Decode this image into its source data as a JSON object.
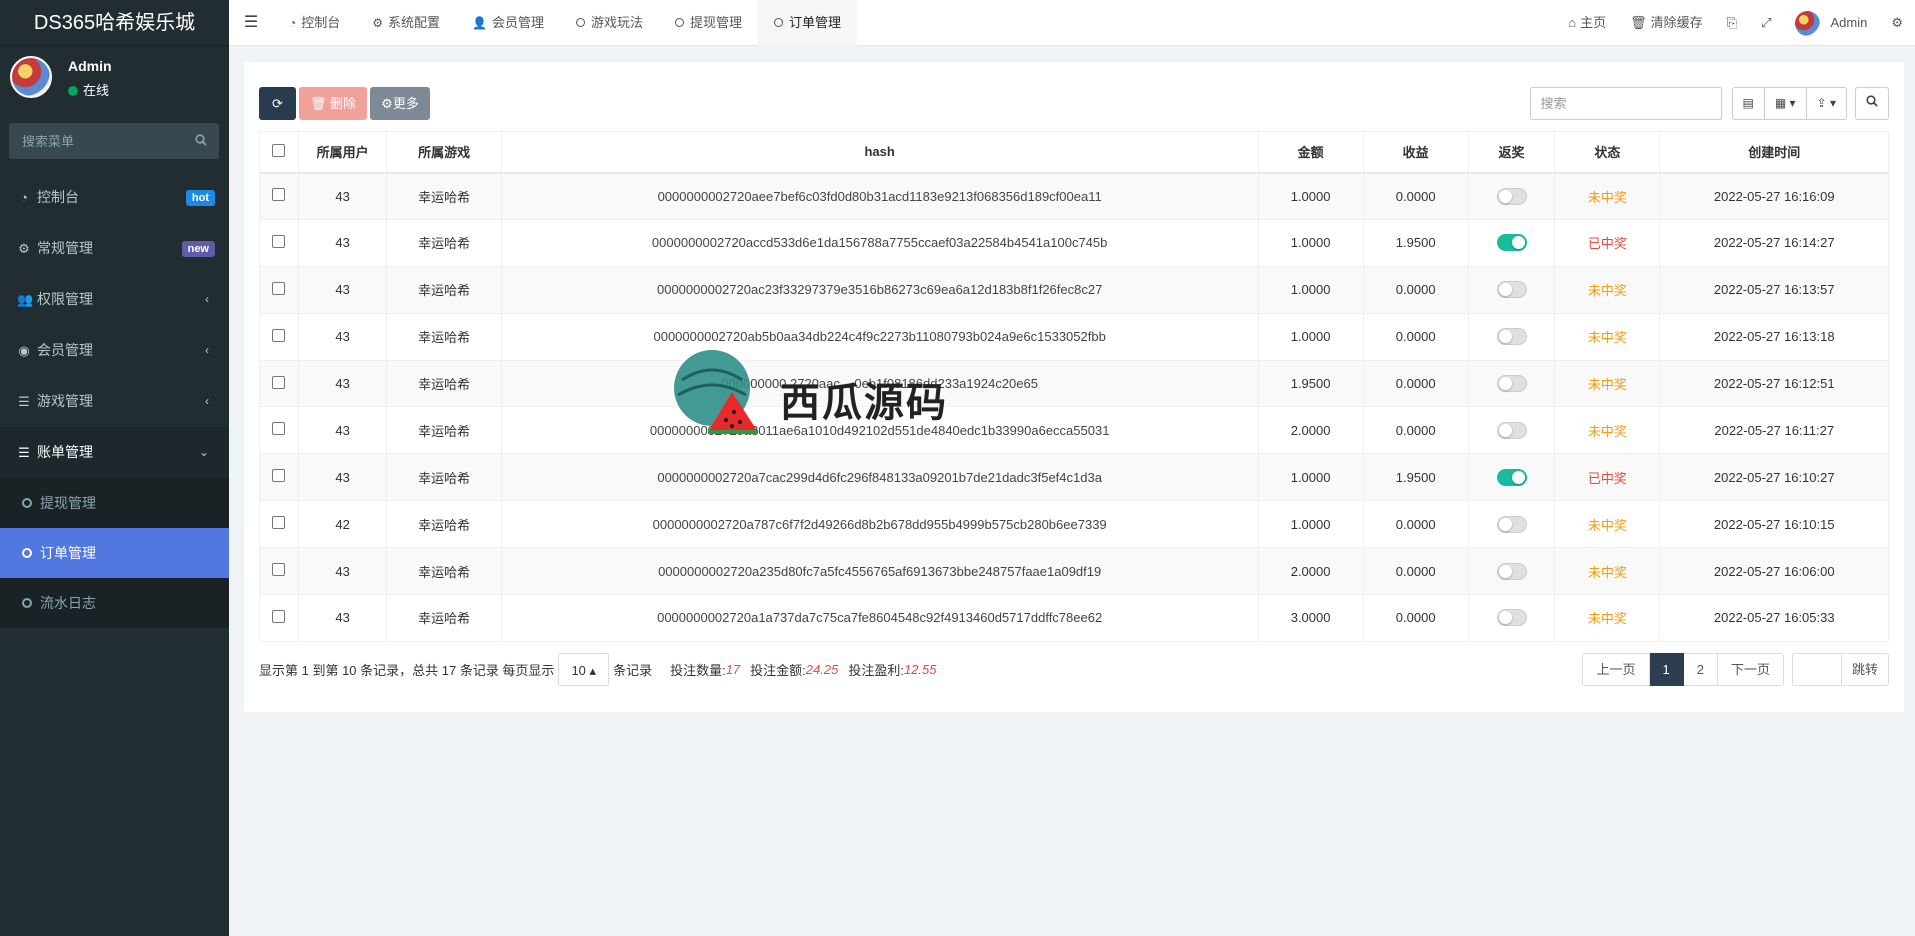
{
  "app": {
    "brand": "DS365哈希娱乐城"
  },
  "user": {
    "name": "Admin",
    "status": "在线"
  },
  "sidebar": {
    "search_placeholder": "搜索菜单",
    "items": [
      {
        "label": "控制台",
        "icon": "dashboard-icon",
        "badge": "hot"
      },
      {
        "label": "常规管理",
        "icon": "cogs-icon",
        "badge": "new"
      },
      {
        "label": "权限管理",
        "icon": "group-icon"
      },
      {
        "label": "会员管理",
        "icon": "user-circle-icon"
      },
      {
        "label": "游戏管理",
        "icon": "list-icon"
      },
      {
        "label": "账单管理",
        "icon": "list-icon"
      }
    ],
    "submenu": [
      {
        "label": "提现管理"
      },
      {
        "label": "订单管理"
      },
      {
        "label": "流水日志"
      }
    ]
  },
  "topbar": {
    "tabs": [
      {
        "label": "控制台",
        "icon": "dashboard-icon"
      },
      {
        "label": "系统配置",
        "icon": "cog-icon"
      },
      {
        "label": "会员管理",
        "icon": "user-icon"
      },
      {
        "label": "游戏玩法",
        "icon": "circle-icon"
      },
      {
        "label": "提现管理",
        "icon": "circle-icon"
      },
      {
        "label": "订单管理",
        "icon": "circle-icon"
      }
    ],
    "home": "主页",
    "clear_cache": "清除缓存",
    "admin": "Admin"
  },
  "toolbar": {
    "delete_label": "删除",
    "more_label": "更多",
    "search_placeholder": "搜索"
  },
  "table": {
    "headers": [
      "所属用户",
      "所属游戏",
      "hash",
      "金额",
      "收益",
      "返奖",
      "状态",
      "创建时间"
    ],
    "rows": [
      {
        "user": "43",
        "game": "幸运哈希",
        "hash": "0000000002720aee7bef6c03fd0d80b31acd1183e9213f068356d189cf00ea11",
        "amount": "1.0000",
        "profit": "0.0000",
        "reward": false,
        "status": "未中奖",
        "time": "2022-05-27 16:16:09"
      },
      {
        "user": "43",
        "game": "幸运哈希",
        "hash": "0000000002720accd533d6e1da156788a7755ccaef03a22584b4541a100c745b",
        "amount": "1.0000",
        "profit": "1.9500",
        "reward": true,
        "status": "已中奖",
        "time": "2022-05-27 16:14:27"
      },
      {
        "user": "43",
        "game": "幸运哈希",
        "hash": "0000000002720ac23f33297379e3516b86273c69ea6a12d183b8f1f26fec8c27",
        "amount": "1.0000",
        "profit": "0.0000",
        "reward": false,
        "status": "未中奖",
        "time": "2022-05-27 16:13:57"
      },
      {
        "user": "43",
        "game": "幸运哈希",
        "hash": "0000000002720ab5b0aa34db224c4f9c2273b11080793b024a9e6c1533052fbb",
        "amount": "1.0000",
        "profit": "0.0000",
        "reward": false,
        "status": "未中奖",
        "time": "2022-05-27 16:13:18"
      },
      {
        "user": "43",
        "game": "幸运哈希",
        "hash": "000000000 2720aac... 0eb1f08186dd233a1924c20e65",
        "amount": "1.9500",
        "profit": "0.0000",
        "reward": false,
        "status": "未中奖",
        "time": "2022-05-27 16:12:51"
      },
      {
        "user": "43",
        "game": "幸运哈希",
        "hash": "0000000002720a3011ae6a1010d492102d551de4840edc1b33990a6ecca55031",
        "amount": "2.0000",
        "profit": "0.0000",
        "reward": false,
        "status": "未中奖",
        "time": "2022-05-27 16:11:27"
      },
      {
        "user": "43",
        "game": "幸运哈希",
        "hash": "0000000002720a7cac299d4d6fc296f848133a09201b7de21dadc3f5ef4c1d3a",
        "amount": "1.0000",
        "profit": "1.9500",
        "reward": true,
        "status": "已中奖",
        "time": "2022-05-27 16:10:27"
      },
      {
        "user": "42",
        "game": "幸运哈希",
        "hash": "0000000002720a787c6f7f2d49266d8b2b678dd955b4999b575cb280b6ee7339",
        "amount": "1.0000",
        "profit": "0.0000",
        "reward": false,
        "status": "未中奖",
        "time": "2022-05-27 16:10:15"
      },
      {
        "user": "43",
        "game": "幸运哈希",
        "hash": "0000000002720a235d80fc7a5fc4556765af6913673bbe248757faae1a09df19",
        "amount": "2.0000",
        "profit": "0.0000",
        "reward": false,
        "status": "未中奖",
        "time": "2022-05-27 16:06:00"
      },
      {
        "user": "43",
        "game": "幸运哈希",
        "hash": "0000000002720a1a737da7c75ca7fe8604548c92f4913460d5717ddffc78ee62",
        "amount": "3.0000",
        "profit": "0.0000",
        "reward": false,
        "status": "未中奖",
        "time": "2022-05-27 16:05:33"
      }
    ]
  },
  "footer": {
    "summary_prefix": "显示第 1 到第 10 条记录，总共 17 条记录 每页显示",
    "page_size": "10",
    "summary_suffix": "条记录",
    "bet_count_label": "投注数量:",
    "bet_count": "17",
    "bet_amount_label": "投注金额:",
    "bet_amount": "24.25",
    "bet_profit_label": "投注盈利:",
    "bet_profit": "12.55"
  },
  "pager": {
    "prev": "上一页",
    "pages": [
      "1",
      "2"
    ],
    "current": "1",
    "next": "下一页",
    "jump": "跳转"
  },
  "watermark": {
    "text": "西瓜源码"
  },
  "colors": {
    "sidebar_bg": "#222d32",
    "active_menu": "#5078e0",
    "lose": "#f39c12",
    "win": "#e74c3c",
    "switch_on": "#18bc9c"
  }
}
